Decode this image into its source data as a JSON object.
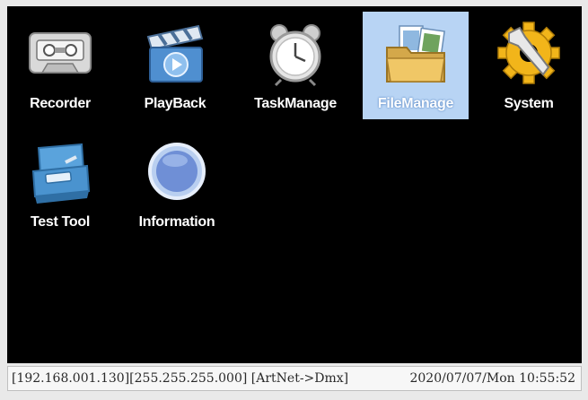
{
  "menu": {
    "items": [
      {
        "label": "Recorder",
        "icon": "cassette-tape-icon"
      },
      {
        "label": "PlayBack",
        "icon": "clapperboard-play-icon"
      },
      {
        "label": "TaskManage",
        "icon": "alarm-clock-icon"
      },
      {
        "label": "FileManage",
        "icon": "folder-icon",
        "selected": true
      },
      {
        "label": "System",
        "icon": "gear-wrench-icon"
      },
      {
        "label": "Test Tool",
        "icon": "toolbox-icon"
      },
      {
        "label": "Information",
        "icon": "info-circle-icon"
      }
    ],
    "selected_color": "#b8d4f4"
  },
  "status": {
    "network": "[192.168.001.130][255.255.255.000] [ArtNet->Dmx]",
    "datetime": "2020/07/07/Mon 10:55:52"
  }
}
